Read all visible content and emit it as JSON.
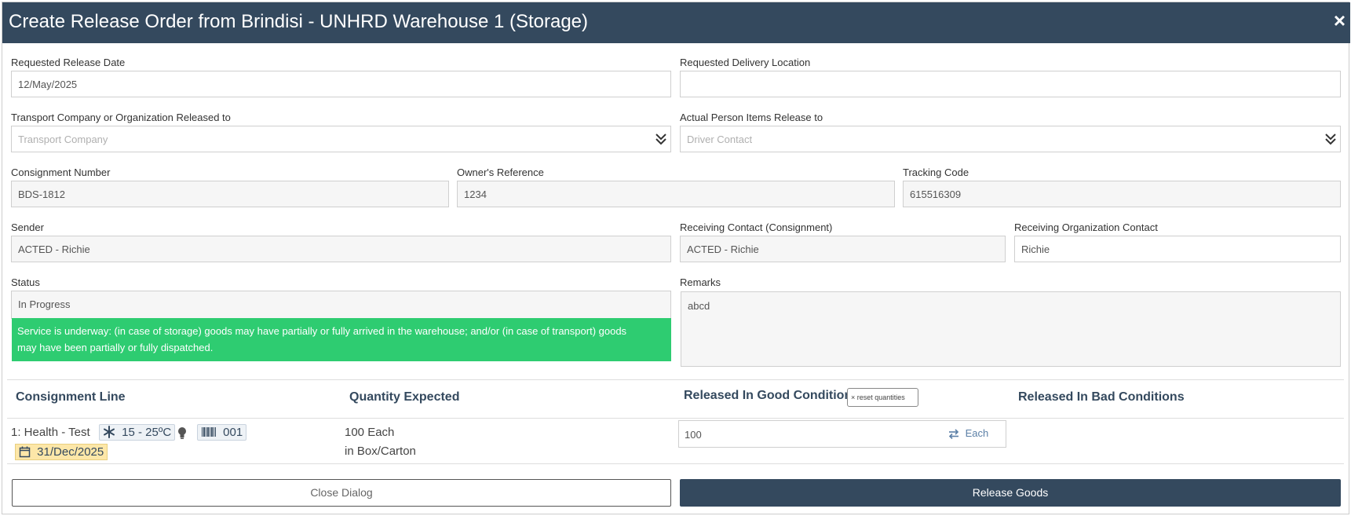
{
  "dialog": {
    "title": "Create Release Order from Brindisi - UNHRD Warehouse 1 (Storage)",
    "close_symbol": "×"
  },
  "form": {
    "requested_release_date": {
      "label": "Requested Release Date",
      "value": "12/May/2025"
    },
    "requested_delivery_location": {
      "label": "Requested Delivery Location",
      "value": ""
    },
    "transport_company": {
      "label": "Transport Company or Organization Released to",
      "placeholder": "Transport Company"
    },
    "actual_person": {
      "label": "Actual Person Items Release to",
      "placeholder": "Driver Contact"
    },
    "consignment_number": {
      "label": "Consignment Number",
      "value": "BDS-1812"
    },
    "owners_reference": {
      "label": "Owner's Reference",
      "value": "1234"
    },
    "tracking_code": {
      "label": "Tracking Code",
      "value": "615516309"
    },
    "sender": {
      "label": "Sender",
      "value": "ACTED - Richie"
    },
    "receiving_contact": {
      "label": "Receiving Contact (Consignment)",
      "value": "ACTED - Richie"
    },
    "receiving_org_contact": {
      "label": "Receiving Organization Contact",
      "value": "Richie"
    },
    "status": {
      "label": "Status",
      "value": "In Progress",
      "note_line1": "Service is underway: (in case of storage) goods may have partially or fully arrived in the warehouse; and/or (in case of transport) goods",
      "note_line2": "may have been partially or fully dispatched.",
      "note_color": "#2ecc71"
    },
    "remarks": {
      "label": "Remarks",
      "value": "abcd"
    }
  },
  "table": {
    "headers": {
      "consignment_line": "Consignment Line",
      "quantity_expected": "Quantity Expected",
      "released_good": "Released In Good Conditions",
      "released_bad": "Released In Bad Conditions"
    },
    "reset_button": "× reset quantities",
    "row": {
      "line_label": "1: Health - Test",
      "temperature": "15 - 25ºC",
      "barcode": "001",
      "expiry_date": "31/Dec/2025",
      "qty_line1": "100 Each",
      "qty_line2": "in Box/Carton",
      "released_good_value": "100",
      "unit": "Each"
    }
  },
  "buttons": {
    "close_dialog": "Close Dialog",
    "release_goods": "Release Goods"
  },
  "colors": {
    "header_bg": "#34495e",
    "status_green": "#2ecc71",
    "date_chip": "#fde7a8"
  }
}
